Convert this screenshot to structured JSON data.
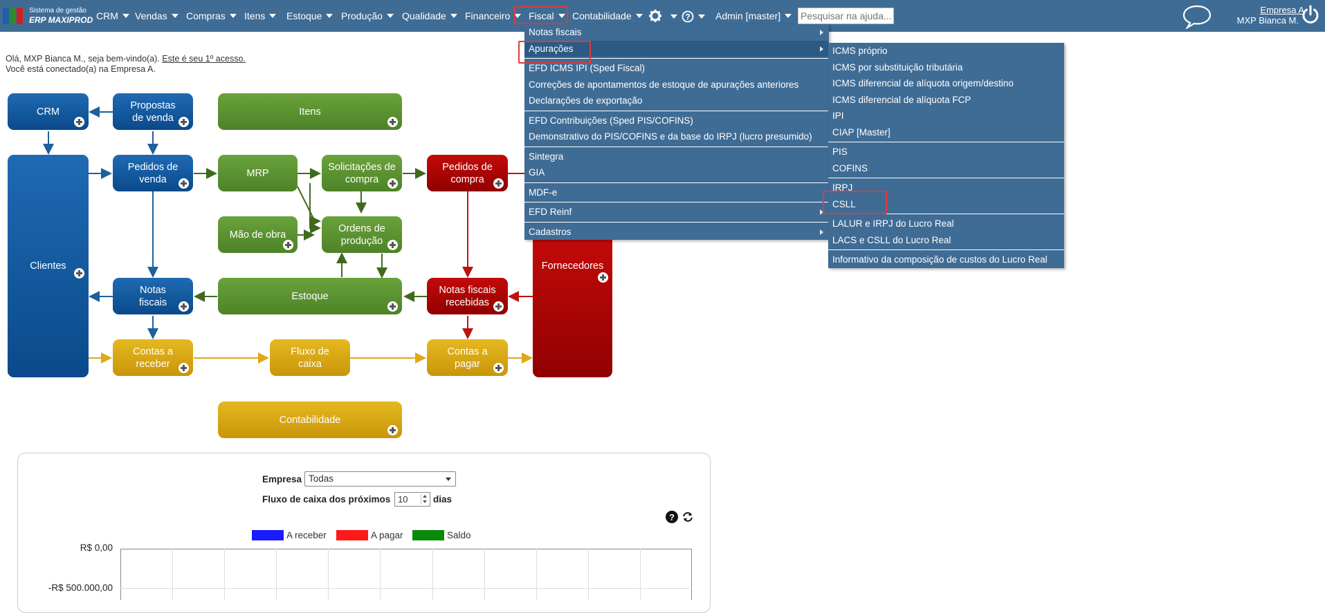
{
  "logo": {
    "line1": "Sistema de gestão",
    "line2": "ERP MAXIPROD"
  },
  "nav": {
    "items": [
      "CRM",
      "Vendas",
      "Compras",
      "Itens",
      "Estoque",
      "Produção",
      "Qualidade",
      "Financeiro",
      "Fiscal",
      "Contabilidade"
    ],
    "admin": "Admin [master]",
    "search_placeholder": "Pesquisar na ajuda...",
    "company_link": "Empresa A",
    "user": "MXP Bianca M."
  },
  "welcome": {
    "greeting": "Olá, MXP Bianca M., seja bem-vindo(a).",
    "first_access": "Este é seu 1º acesso.",
    "connected": "Você está conectado(a) na Empresa A."
  },
  "flow": {
    "crm": "CRM",
    "propostas": "Propostas de venda",
    "itens": "Itens",
    "pedidos_venda": "Pedidos de venda",
    "mrp": "MRP",
    "solicitacoes": "Solicitações de compra",
    "pedidos_compra": "Pedidos de compra",
    "mao_obra": "Mão de obra",
    "ordens": "Ordens de produção",
    "clientes": "Clientes",
    "fornecedores": "Fornecedores",
    "notas_fiscais": "Notas fiscais",
    "estoque": "Estoque",
    "nf_recebidas": "Notas fiscais recebidas",
    "contas_receber": "Contas a receber",
    "fluxo_caixa": "Fluxo de caixa",
    "contas_pagar": "Contas a pagar",
    "contabilidade": "Contabilidade"
  },
  "fiscal_menu": [
    {
      "label": "Notas fiscais",
      "sub": true
    },
    {
      "label": "Apurações",
      "sub": true,
      "active": true
    },
    {
      "label": "EFD ICMS IPI (Sped Fiscal)"
    },
    {
      "label": "Correções de apontamentos de estoque de apurações anteriores"
    },
    {
      "label": "Declarações de exportação"
    },
    {
      "label": "EFD Contribuições (Sped PIS/COFINS)"
    },
    {
      "label": "Demonstrativo do PIS/COFINS e da base do IRPJ (lucro presumido)"
    },
    {
      "label": "Sintegra"
    },
    {
      "label": "GIA"
    },
    {
      "label": "MDF-e"
    },
    {
      "label": "EFD Reinf",
      "sub": true
    },
    {
      "label": "Cadastros",
      "sub": true
    }
  ],
  "apuracoes_menu": [
    "ICMS próprio",
    "ICMS por substituição tributária",
    "ICMS diferencial de alíquota origem/destino",
    "ICMS diferencial de alíquota FCP",
    "IPI",
    "CIAP [Master]",
    "PIS",
    "COFINS",
    "IRPJ",
    "CSLL",
    "LALUR e IRPJ do Lucro Real",
    "LACS e CSLL do Lucro Real",
    "Informativo da composição de custos do Lucro Real"
  ],
  "panel": {
    "empresa_label": "Empresa",
    "empresa_value": "Todas",
    "fluxo_label": "Fluxo de caixa dos próximos",
    "days_value": "10",
    "days_suffix": "dias"
  },
  "chart_data": {
    "type": "line",
    "series": [
      {
        "name": "A receber",
        "color": "#1a1aff",
        "values": []
      },
      {
        "name": "A pagar",
        "color": "#ff1a1a",
        "values": []
      },
      {
        "name": "Saldo",
        "color": "#0a8a0a",
        "values": []
      }
    ],
    "y_tick_labels": [
      "R$ 0,00",
      "-R$ 500.000,00"
    ]
  }
}
